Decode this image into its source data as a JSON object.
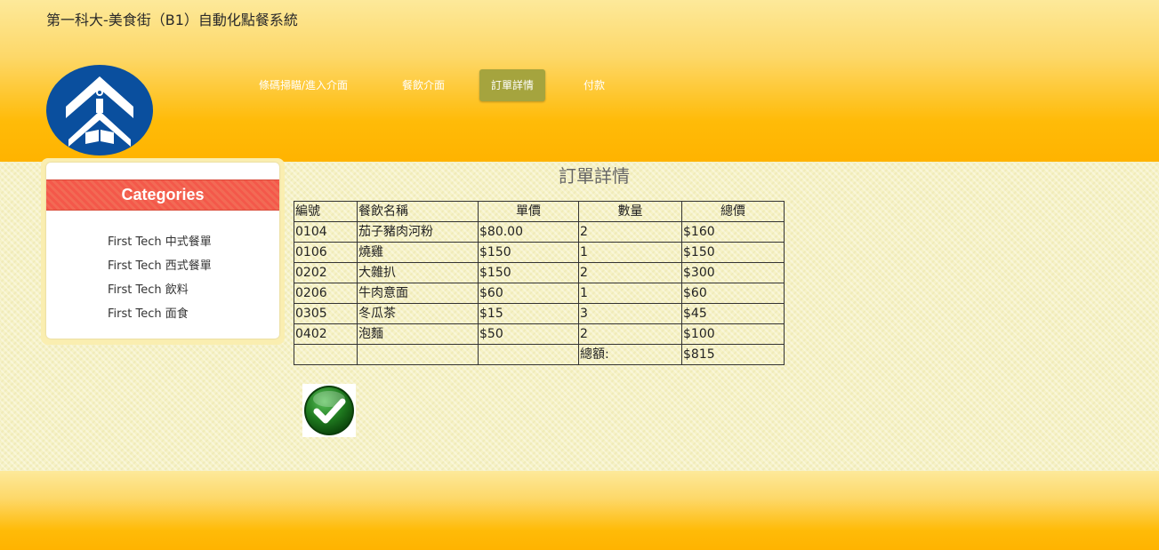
{
  "site": {
    "title": "第一科大-美食街（B1）自動化點餐系統"
  },
  "nav": {
    "items": [
      {
        "label": "條碼掃瞄/進入介面"
      },
      {
        "label": "餐飲介面"
      },
      {
        "label": "訂單詳情",
        "active": true
      },
      {
        "label": "付款"
      }
    ],
    "active_color": "#a5a43e"
  },
  "sidebar": {
    "header": "Categories",
    "items": [
      {
        "label": "First Tech 中式餐單"
      },
      {
        "label": "First Tech 西式餐單"
      },
      {
        "label": "First Tech 飲料"
      },
      {
        "label": "First Tech 面食"
      }
    ],
    "header_color": "#f4584a"
  },
  "order": {
    "title": "訂單詳情",
    "columns": [
      "編號",
      "餐飲名稱",
      "單價",
      "數量",
      "總價"
    ],
    "rows": [
      [
        "0104",
        "茄子豬肉河粉",
        "$80.00",
        "2",
        "$160"
      ],
      [
        "0106",
        "燒雞",
        "$150",
        "1",
        "$150"
      ],
      [
        "0202",
        "大雜扒",
        "$150",
        "2",
        "$300"
      ],
      [
        "0206",
        "牛肉意面",
        "$60",
        "1",
        "$60"
      ],
      [
        "0305",
        "冬瓜茶",
        "$15",
        "3",
        "$45"
      ],
      [
        "0402",
        "泡麵",
        "$50",
        "2",
        "$100"
      ]
    ],
    "total_label": "總額:",
    "total_value": "$815"
  },
  "confirm": {
    "icon": "check-icon",
    "color": "#1f7a1f"
  },
  "colors": {
    "header_gradient_end": "#ffb300",
    "content_bg": "#f6f2c6"
  }
}
